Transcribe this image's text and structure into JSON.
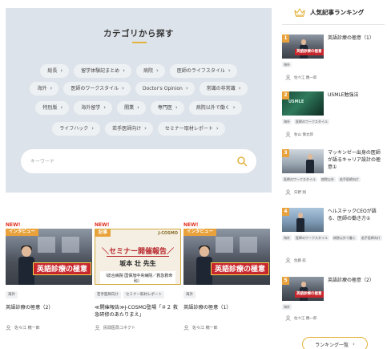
{
  "category": {
    "title": "カテゴリから探す",
    "rows": [
      [
        "総長",
        "留学体験記まとめ",
        "病院",
        "医師のライフスタイル"
      ],
      [
        "海外",
        "医師のワークスタイル",
        "Doctor's Opinion",
        "常識の非常識"
      ],
      [
        "特別版",
        "海外留学",
        "開業",
        "専門医",
        "病院以外で働く"
      ],
      [
        "ライフハック",
        "若手医師向け",
        "セミナー取材レポート"
      ]
    ],
    "search_placeholder": "キーワード"
  },
  "articles": [
    {
      "new": "NEW!",
      "badge": "インタビュー",
      "banner": "英語診療の極意",
      "tags": [
        "海外"
      ],
      "title": "英語診療の極意（2）",
      "author": "佐々江 穂一郎"
    },
    {
      "new": "NEW!",
      "badge": "記事",
      "seminar_head": "＼セミナー開催報告／",
      "seminar_name": "坂本 壮 先生",
      "seminar_org": "（総合病院 国保旭中央病院／救急救命科）",
      "seminar_brand": "J-COSMO",
      "tags": [
        "若手医師向け",
        "セミナー取材レポート"
      ],
      "title": "≪開催報告≫J-COSMO塾場「＃２ 救急研修のあたりまえ」",
      "author": "民間医局コネクト"
    },
    {
      "new": "NEW!",
      "badge": "インタビュー",
      "banner": "英語診療の極意",
      "tags": [
        "海外"
      ],
      "title": "英語診療の極意（1）",
      "author": "佐々江 穂一郎"
    }
  ],
  "ranking": {
    "title": "人気記事ランキング",
    "items": [
      {
        "rank": "1",
        "title": "英語診療の極意（1）",
        "tags": [
          "海外"
        ],
        "author": "佐々江 穂一郎",
        "mini_banner": "英語診療の極意"
      },
      {
        "rank": "2",
        "title": "USMLE勉強法",
        "tags": [
          "海外",
          "医師のワークスタイル"
        ],
        "author": "秋山 慎太郎",
        "thumb_text": "USMLE"
      },
      {
        "rank": "3",
        "title": "マッキンゼー出身の医師が語るキャリア設計の極意①",
        "tags": [
          "医師のワークスタイル",
          "病院以外",
          "若手医師向け"
        ],
        "author": "矢野 翔"
      },
      {
        "rank": "4",
        "title": "ヘルステックCEOが語る、医師の働き方①",
        "tags": [
          "海外",
          "医師のワークスタイル",
          "病院以外で働く",
          "若手医師向け"
        ],
        "author": "佐藤 航"
      },
      {
        "rank": "5",
        "title": "英語診療の極意（2）",
        "tags": [
          "海外"
        ],
        "author": "佐々江 穂一郎",
        "mini_banner": "英語診療の極意"
      }
    ],
    "more_label": "ランキング一覧"
  },
  "colors": {
    "accent": "#e3b23c",
    "badge": "#e9a23b",
    "new": "#e0301e",
    "panel": "#dde3ea"
  },
  "icons": {
    "search": "search-icon",
    "crown": "crown-icon",
    "author": "user-icon",
    "chevron": "chevron-right-icon"
  }
}
